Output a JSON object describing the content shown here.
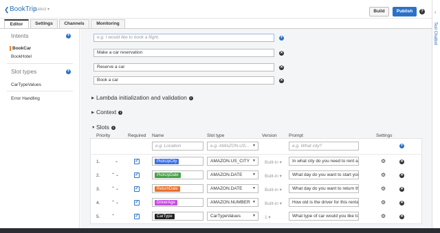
{
  "header": {
    "bot_name": "BookTrip",
    "version": "Latest",
    "build_label": "Build",
    "publish_label": "Publish",
    "help_glyph": "?"
  },
  "tabs": [
    {
      "label": "Editor",
      "active": true
    },
    {
      "label": "Settings",
      "active": false
    },
    {
      "label": "Channels",
      "active": false
    },
    {
      "label": "Monitoring",
      "active": false
    }
  ],
  "sidebar": {
    "intents_heading": "Intents",
    "intents": [
      "BookCar",
      "BookHotel"
    ],
    "slot_types_heading": "Slot types",
    "slot_types": [
      "CarTypeValues"
    ],
    "error_handling": "Error Handling"
  },
  "utterances": {
    "placeholder": "e.g. I would like to book a flight.",
    "items": [
      "Make a car reservation",
      "Reserve a car",
      "Book a car"
    ]
  },
  "sections": {
    "lambda": "Lambda initialization and validation",
    "context": "Context",
    "slots": "Slots"
  },
  "slots_table": {
    "headers": {
      "priority": "Priority",
      "required": "Required",
      "name": "Name",
      "slot_type": "Slot type",
      "version": "Version",
      "prompt": "Prompt",
      "settings": "Settings"
    },
    "new_row": {
      "name_placeholder": "e.g. Location",
      "type_placeholder": "e.g. AMAZON.US...",
      "prompt_placeholder": "e.g. What city?"
    },
    "rows": [
      {
        "priority": "1.",
        "name": "PickUpCity",
        "chip_color": "#3b6ee8",
        "slot_type": "AMAZON.US_CITY",
        "version": "Built-in",
        "prompt": "In what city do you need to rent a c"
      },
      {
        "priority": "2.",
        "name": "PickUpDate",
        "chip_color": "#46a046",
        "slot_type": "AMAZON.DATE",
        "version": "Built-in",
        "prompt": "What day do you want to start you"
      },
      {
        "priority": "3.",
        "name": "ReturnDate",
        "chip_color": "#e8702a",
        "slot_type": "AMAZON.DATE",
        "version": "Built-in",
        "prompt": "What day do you want to return the"
      },
      {
        "priority": "4.",
        "name": "DriverAge",
        "chip_color": "#c64ee0",
        "slot_type": "AMAZON.NUMBER",
        "version": "Built-in",
        "prompt": "How old is the driver for this rental"
      },
      {
        "priority": "5.",
        "name": "CarType",
        "chip_color": "#222222",
        "slot_type": "CarTypeValues",
        "version": "1",
        "prompt": "What type of car would you like to"
      }
    ]
  },
  "test_panel": {
    "label": "Test Chatbot"
  },
  "colors": {
    "accent": "#2b72c7",
    "active_intent": "#f0861e"
  }
}
